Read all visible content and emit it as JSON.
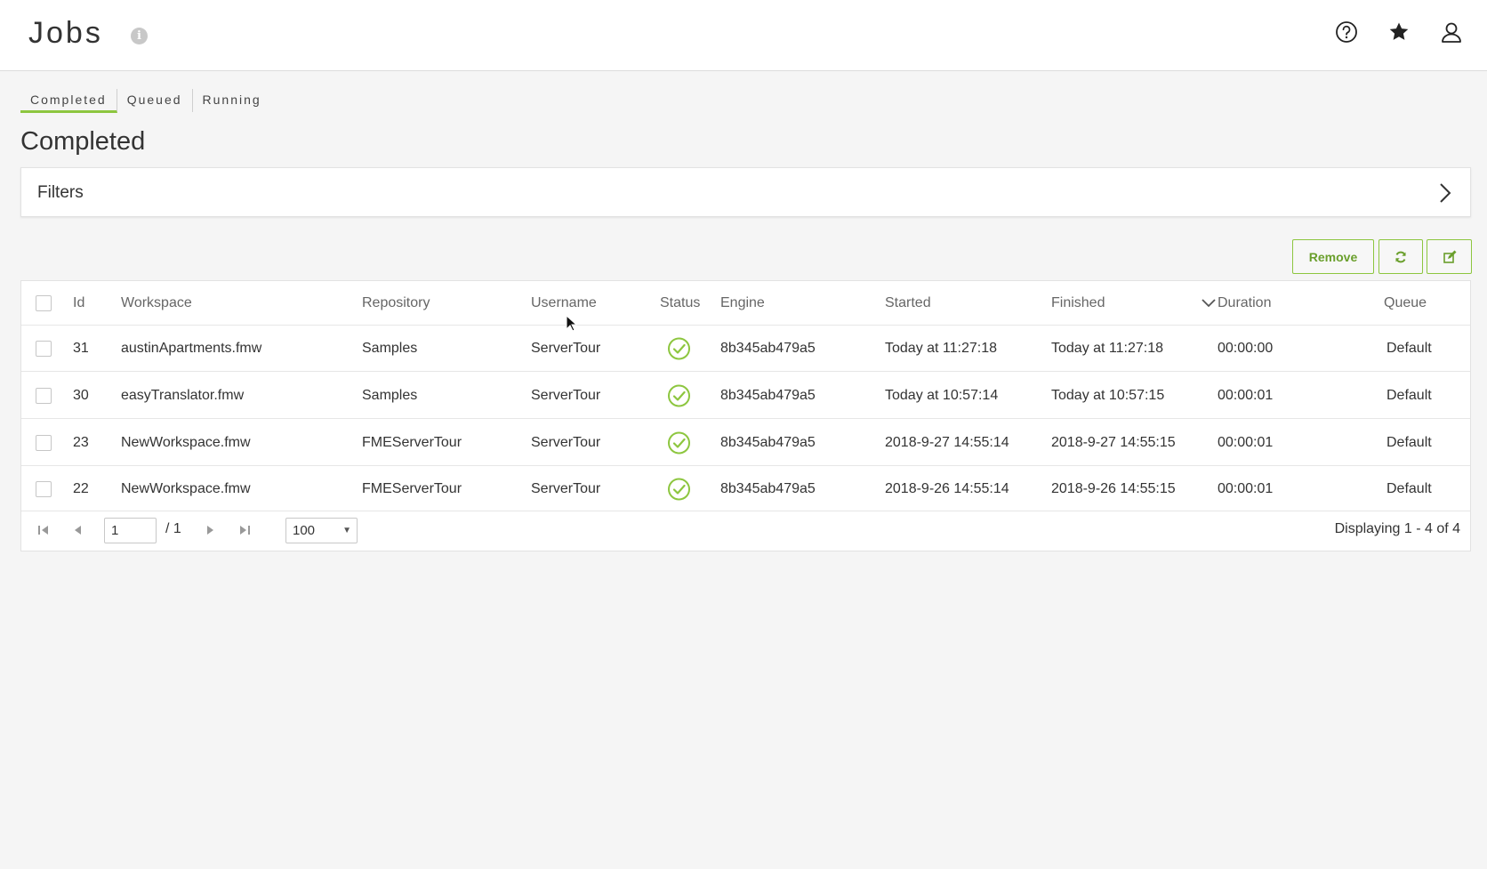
{
  "header": {
    "title": "Jobs",
    "info_icon": "info-icon",
    "icons": [
      "help-icon",
      "star-icon",
      "user-icon"
    ]
  },
  "tabs": [
    {
      "label": "Completed",
      "active": true
    },
    {
      "label": "Queued",
      "active": false
    },
    {
      "label": "Running",
      "active": false
    }
  ],
  "section_title": "Completed",
  "filters": {
    "label": "Filters",
    "icon": "chevron-right-icon"
  },
  "actions": {
    "remove_label": "Remove",
    "refresh_icon": "refresh-icon",
    "edit_icon": "edit-icon"
  },
  "table": {
    "columns": [
      "Id",
      "Workspace",
      "Repository",
      "Username",
      "Status",
      "Engine",
      "Started",
      "Finished",
      "Duration",
      "Queue"
    ],
    "sorted_column": "Finished",
    "rows": [
      {
        "id": "31",
        "workspace": "austinApartments.fmw",
        "repository": "Samples",
        "username": "ServerTour",
        "status": "success",
        "engine": "8b345ab479a5",
        "started": "Today at 11:27:18",
        "finished": "Today at 11:27:18",
        "duration": "00:00:00",
        "queue": "Default"
      },
      {
        "id": "30",
        "workspace": "easyTranslator.fmw",
        "repository": "Samples",
        "username": "ServerTour",
        "status": "success",
        "engine": "8b345ab479a5",
        "started": "Today at 10:57:14",
        "finished": "Today at 10:57:15",
        "duration": "00:00:01",
        "queue": "Default"
      },
      {
        "id": "23",
        "workspace": "NewWorkspace.fmw",
        "repository": "FMEServerTour",
        "username": "ServerTour",
        "status": "success",
        "engine": "8b345ab479a5",
        "started": "2018-9-27 14:55:14",
        "finished": "2018-9-27 14:55:15",
        "duration": "00:00:01",
        "queue": "Default"
      },
      {
        "id": "22",
        "workspace": "NewWorkspace.fmw",
        "repository": "FMEServerTour",
        "username": "ServerTour",
        "status": "success",
        "engine": "8b345ab479a5",
        "started": "2018-9-26 14:55:14",
        "finished": "2018-9-26 14:55:15",
        "duration": "00:00:01",
        "queue": "Default"
      }
    ]
  },
  "pager": {
    "current_page": "1",
    "total_pages": "/ 1",
    "page_size": "100",
    "display_text": "Displaying 1 - 4 of 4"
  },
  "colors": {
    "accent": "#8dc63f",
    "accent_text": "#6a9f2c"
  }
}
